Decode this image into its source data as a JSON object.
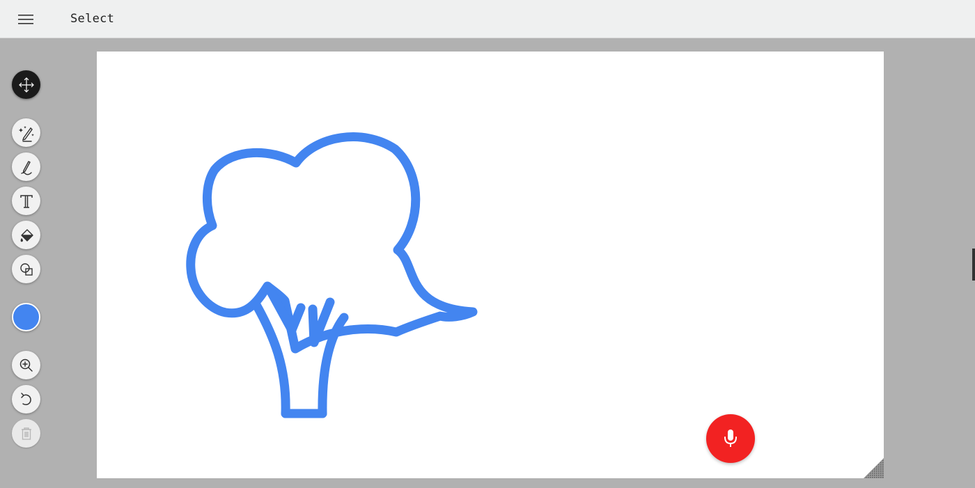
{
  "header": {
    "menu_icon": "hamburger-menu-icon",
    "title": "Select"
  },
  "toolbar": {
    "tools": [
      {
        "name": "select-move",
        "icon": "move-arrows-icon",
        "active": true
      },
      {
        "name": "autodraw",
        "icon": "magic-pencil-icon",
        "active": false
      },
      {
        "name": "draw",
        "icon": "pencil-icon",
        "active": false
      },
      {
        "name": "type",
        "icon": "text-t-icon",
        "active": false
      },
      {
        "name": "fill",
        "icon": "paint-bucket-icon",
        "active": false
      },
      {
        "name": "shape",
        "icon": "shapes-icon",
        "active": false
      },
      {
        "name": "zoom",
        "icon": "zoom-in-icon",
        "active": false
      },
      {
        "name": "undo",
        "icon": "undo-icon",
        "active": false
      },
      {
        "name": "delete",
        "icon": "trash-icon",
        "disabled": true
      }
    ],
    "selected_color": "#4385f0"
  },
  "canvas": {
    "background": "#ffffff",
    "drawing": "broccoli",
    "stroke_color": "#4385f0"
  },
  "mic_button": {
    "icon": "microphone-icon",
    "color": "#f22222"
  }
}
